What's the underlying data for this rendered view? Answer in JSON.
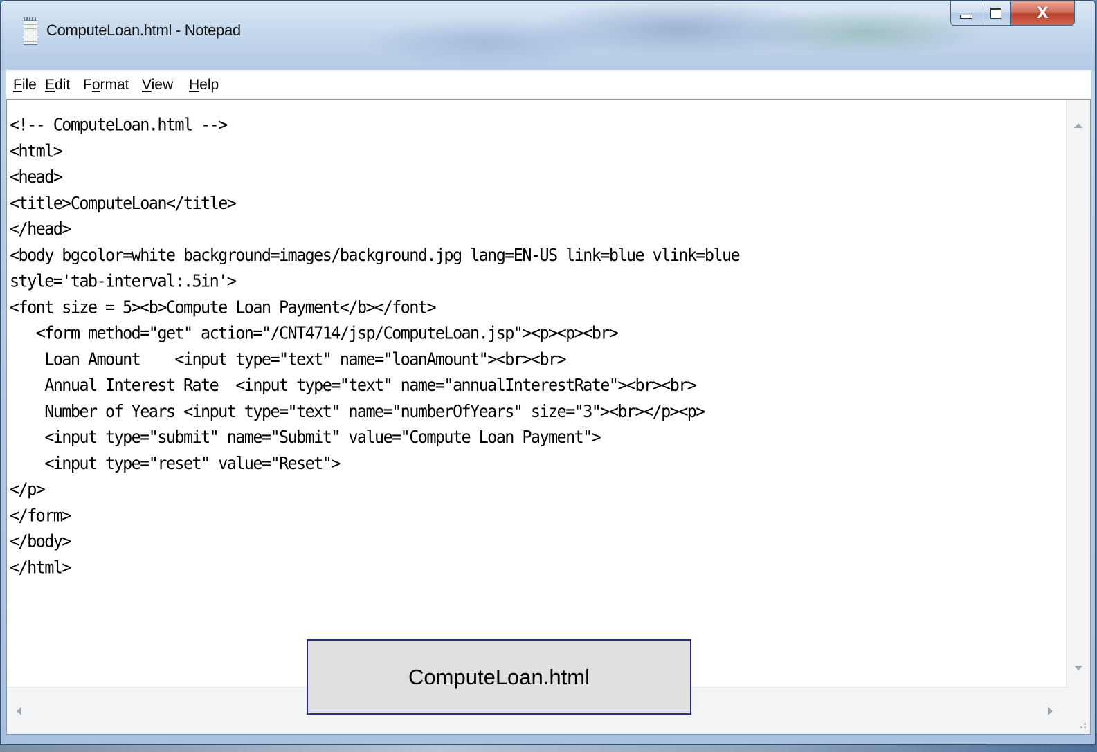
{
  "window": {
    "title": "ComputeLoan.html - Notepad",
    "close_glyph": "X"
  },
  "menu": [
    {
      "accel": "F",
      "rest": "ile"
    },
    {
      "accel": "E",
      "rest": "dit"
    },
    {
      "pre": "F",
      "accel": "o",
      "rest": "rmat"
    },
    {
      "accel": "V",
      "rest": "iew"
    },
    {
      "accel": "H",
      "rest": "elp"
    }
  ],
  "editor": {
    "lines": [
      "<!-- ComputeLoan.html -->",
      "<html>",
      "<head>",
      "<title>ComputeLoan</title>",
      "</head>",
      "<body bgcolor=white background=images/background.jpg lang=EN-US link=blue vlink=blue",
      "style='tab-interval:.5in'>",
      "<font size = 5><b>Compute Loan Payment</b></font>",
      "   <form method=\"get\" action=\"/CNT4714/jsp/ComputeLoan.jsp\"><p><p><br>",
      "    Loan Amount    <input type=\"text\" name=\"loanAmount\"><br><br>",
      "    Annual Interest Rate  <input type=\"text\" name=\"annualInterestRate\"><br><br>",
      "    Number of Years <input type=\"text\" name=\"numberOfYears\" size=\"3\"><br></p><p>",
      "    <input type=\"submit\" name=\"Submit\" value=\"Compute Loan Payment\">",
      "    <input type=\"reset\" value=\"Reset\">",
      "</p>",
      "</form>",
      "</body>",
      "</html>"
    ]
  },
  "caption": {
    "label": "ComputeLoan.html"
  }
}
